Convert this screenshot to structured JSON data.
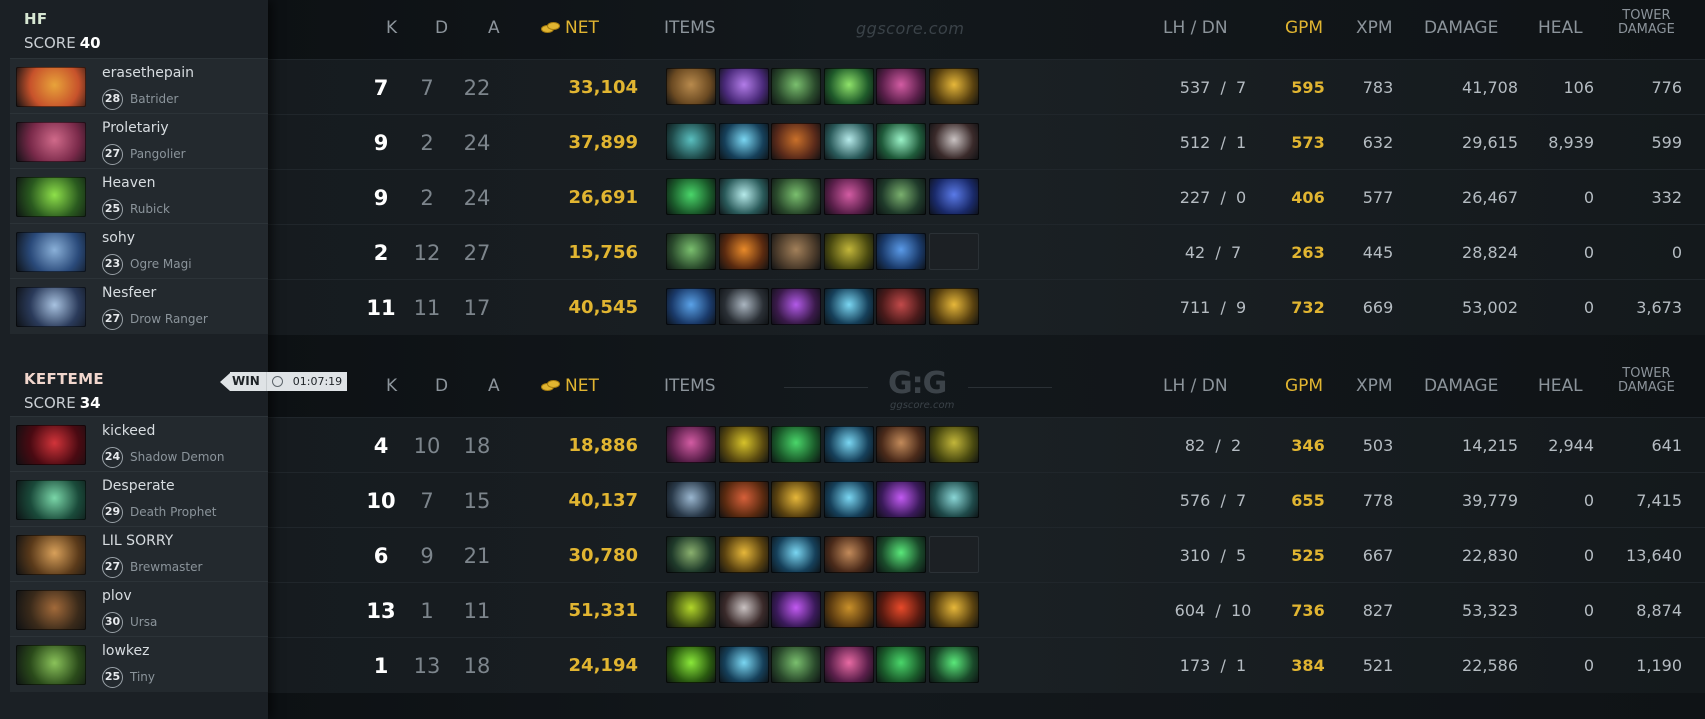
{
  "columns": {
    "k": "K",
    "d": "D",
    "a": "A",
    "net": "NET",
    "items": "ITEMS",
    "lh_dn": "LH  /  DN",
    "gpm": "GPM",
    "xpm": "XPM",
    "damage": "DAMAGE",
    "heal": "HEAL",
    "tower_line1": "TOWER",
    "tower_line2": "DAMAGE"
  },
  "watermarks": {
    "top": "ggscore.com",
    "logo": "G:G",
    "logo_sub": "ggscore.com"
  },
  "result": {
    "label": "WIN",
    "duration": "01:07:19"
  },
  "colors": {
    "gold": "#e1b531",
    "team1_name": "#d7e6d2",
    "team2_name": "#f1d6cd"
  },
  "teams": [
    {
      "name": "HF",
      "score_label": "SCORE",
      "score": "40",
      "players": [
        {
          "name": "erasethepain",
          "level": "28",
          "hero": "Batrider",
          "k": "7",
          "d": "7",
          "a": "22",
          "net": "33,104",
          "lh": "537",
          "dn": "7",
          "gpm": "595",
          "xpm": "783",
          "damage": "41,708",
          "heal": "106",
          "tower": "776",
          "portrait": [
            "#c7522b",
            "#e8a33a"
          ],
          "items": [
            [
              "#6b4a22",
              "#b88a4d"
            ],
            [
              "#4a2a7a",
              "#b27ce8"
            ],
            [
              "#2a4a2c",
              "#7abf6e"
            ],
            [
              "#1f5a2a",
              "#8fe36a"
            ],
            [
              "#5a1f4a",
              "#d35ca3"
            ],
            [
              "#5a4210",
              "#e6b73a"
            ]
          ]
        },
        {
          "name": "Proletariy",
          "level": "27",
          "hero": "Pangolier",
          "k": "9",
          "d": "2",
          "a": "24",
          "net": "37,899",
          "lh": "512",
          "dn": "1",
          "gpm": "573",
          "xpm": "632",
          "damage": "29,615",
          "heal": "8,939",
          "tower": "599",
          "portrait": [
            "#7a2a4a",
            "#d06a8a"
          ],
          "items": [
            [
              "#1f4a4a",
              "#5abfbf"
            ],
            [
              "#16405a",
              "#7ad6f2"
            ],
            [
              "#5a2a1a",
              "#c9702a"
            ],
            [
              "#2a5a5a",
              "#b6eaea"
            ],
            [
              "#1f5a3a",
              "#9af2c7"
            ],
            [
              "#3a2a2a",
              "#c9c2c2"
            ]
          ]
        },
        {
          "name": "Heaven",
          "level": "25",
          "hero": "Rubick",
          "k": "9",
          "d": "2",
          "a": "24",
          "net": "26,691",
          "lh": "227",
          "dn": "0",
          "gpm": "406",
          "xpm": "577",
          "damage": "26,467",
          "heal": "0",
          "tower": "332",
          "portrait": [
            "#2a5a1f",
            "#8ee04a"
          ],
          "items": [
            [
              "#1a5a2a",
              "#4ad66a"
            ],
            [
              "#2a5a5a",
              "#b6eaea"
            ],
            [
              "#2a4a2c",
              "#7abf6e"
            ],
            [
              "#5a1f4a",
              "#d35ca3"
            ],
            [
              "#1f3a2a",
              "#7ab06e"
            ],
            [
              "#1a2a6a",
              "#5a7ae8"
            ]
          ]
        },
        {
          "name": "sohy",
          "level": "23",
          "hero": "Ogre Magi",
          "k": "2",
          "d": "12",
          "a": "27",
          "net": "15,756",
          "lh": "42",
          "dn": "7",
          "gpm": "263",
          "xpm": "445",
          "damage": "28,824",
          "heal": "0",
          "tower": "0",
          "portrait": [
            "#2a4a7a",
            "#8ab0d8"
          ],
          "items": [
            [
              "#2a4a2c",
              "#7abf6e"
            ],
            [
              "#5a2a10",
              "#e88a2a"
            ],
            [
              "#4a3a2a",
              "#a2805a"
            ],
            [
              "#4a4a10",
              "#c2b63a"
            ],
            [
              "#1a3a6a",
              "#5a9ae8"
            ],
            [
              "#1a1d20",
              "#24292d"
            ]
          ]
        },
        {
          "name": "Nesfeer",
          "level": "27",
          "hero": "Drow Ranger",
          "k": "11",
          "d": "11",
          "a": "17",
          "net": "40,545",
          "lh": "711",
          "dn": "9",
          "gpm": "732",
          "xpm": "669",
          "damage": "53,002",
          "heal": "0",
          "tower": "3,673",
          "portrait": [
            "#2a3a5a",
            "#a8c2e0"
          ],
          "items": [
            [
              "#1a3a6a",
              "#5aa2e8"
            ],
            [
              "#2a2f35",
              "#aab5c0"
            ],
            [
              "#3a1a4a",
              "#b25ae8"
            ],
            [
              "#16405a",
              "#7ad6f2"
            ],
            [
              "#4a1a1a",
              "#c24a4a"
            ],
            [
              "#5a4210",
              "#e6b73a"
            ]
          ]
        }
      ]
    },
    {
      "name": "KEFTEME",
      "score_label": "SCORE",
      "score": "34",
      "players": [
        {
          "name": "kickeed",
          "level": "24",
          "hero": "Shadow Demon",
          "k": "4",
          "d": "10",
          "a": "18",
          "net": "18,886",
          "lh": "82",
          "dn": "2",
          "gpm": "346",
          "xpm": "503",
          "damage": "14,215",
          "heal": "2,944",
          "tower": "641",
          "portrait": [
            "#4a0a12",
            "#d2343a"
          ],
          "items": [
            [
              "#5a1f4a",
              "#d35ca3"
            ],
            [
              "#5a4a10",
              "#d6c22a"
            ],
            [
              "#1a5a2a",
              "#4ad66a"
            ],
            [
              "#16405a",
              "#7ad6f2"
            ],
            [
              "#4a2a1a",
              "#c28a5a"
            ],
            [
              "#4a4a10",
              "#c2b63a"
            ]
          ]
        },
        {
          "name": "Desperate",
          "level": "29",
          "hero": "Death Prophet",
          "k": "10",
          "d": "7",
          "a": "15",
          "net": "40,137",
          "lh": "576",
          "dn": "7",
          "gpm": "655",
          "xpm": "778",
          "damage": "39,779",
          "heal": "0",
          "tower": "7,415",
          "portrait": [
            "#1a4a3a",
            "#7ad6a8"
          ],
          "items": [
            [
              "#2a3a4a",
              "#9ab6cf"
            ],
            [
              "#5a2a10",
              "#d6603a"
            ],
            [
              "#5a4210",
              "#e6b73a"
            ],
            [
              "#16405a",
              "#7ad6f2"
            ],
            [
              "#3a1a5a",
              "#c25af2"
            ],
            [
              "#1f4a4a",
              "#8ad6d6"
            ],
            [
              "#1a1d20",
              "#24292d"
            ]
          ]
        },
        {
          "name": "LIL SORRY",
          "level": "27",
          "hero": "Brewmaster",
          "k": "6",
          "d": "9",
          "a": "21",
          "net": "30,780",
          "lh": "310",
          "dn": "5",
          "gpm": "525",
          "xpm": "667",
          "damage": "22,830",
          "heal": "0",
          "tower": "13,640",
          "portrait": [
            "#5a3a1a",
            "#d8a05a"
          ],
          "items": [
            [
              "#1f3a2a",
              "#8ab06e"
            ],
            [
              "#5a4210",
              "#e6b73a"
            ],
            [
              "#16405a",
              "#7ad6f2"
            ],
            [
              "#4a2a1a",
              "#c28a5a"
            ],
            [
              "#1a4a2a",
              "#5ae87a"
            ],
            [
              "#1a1d20",
              "#24292d"
            ]
          ]
        },
        {
          "name": "plov",
          "level": "30",
          "hero": "Ursa",
          "k": "13",
          "d": "1",
          "a": "11",
          "net": "51,331",
          "lh": "604",
          "dn": "10",
          "gpm": "736",
          "xpm": "827",
          "damage": "53,323",
          "heal": "0",
          "tower": "8,874",
          "portrait": [
            "#3a2a1a",
            "#a26a3a"
          ],
          "items": [
            [
              "#3a4a10",
              "#b2d62a"
            ],
            [
              "#3a2a2a",
              "#c9c2c2"
            ],
            [
              "#3a1a5a",
              "#c25af2"
            ],
            [
              "#5a3a10",
              "#c9902a"
            ],
            [
              "#5a1a10",
              "#e84a2a"
            ],
            [
              "#5a4210",
              "#e6b73a"
            ]
          ]
        },
        {
          "name": "lowkez",
          "level": "25",
          "hero": "Tiny",
          "k": "1",
          "d": "13",
          "a": "18",
          "net": "24,194",
          "lh": "173",
          "dn": "1",
          "gpm": "384",
          "xpm": "521",
          "damage": "22,586",
          "heal": "0",
          "tower": "1,190",
          "portrait": [
            "#2a4a1a",
            "#8ac25a"
          ],
          "items": [
            [
              "#2a5a10",
              "#8ae83a"
            ],
            [
              "#16405a",
              "#7ad6f2"
            ],
            [
              "#2a4a2c",
              "#7abf6e"
            ],
            [
              "#5a1f4a",
              "#e86aa3"
            ],
            [
              "#1a5a2a",
              "#4ad66a"
            ],
            [
              "#1a4a2a",
              "#5ae87a"
            ]
          ]
        }
      ]
    }
  ]
}
